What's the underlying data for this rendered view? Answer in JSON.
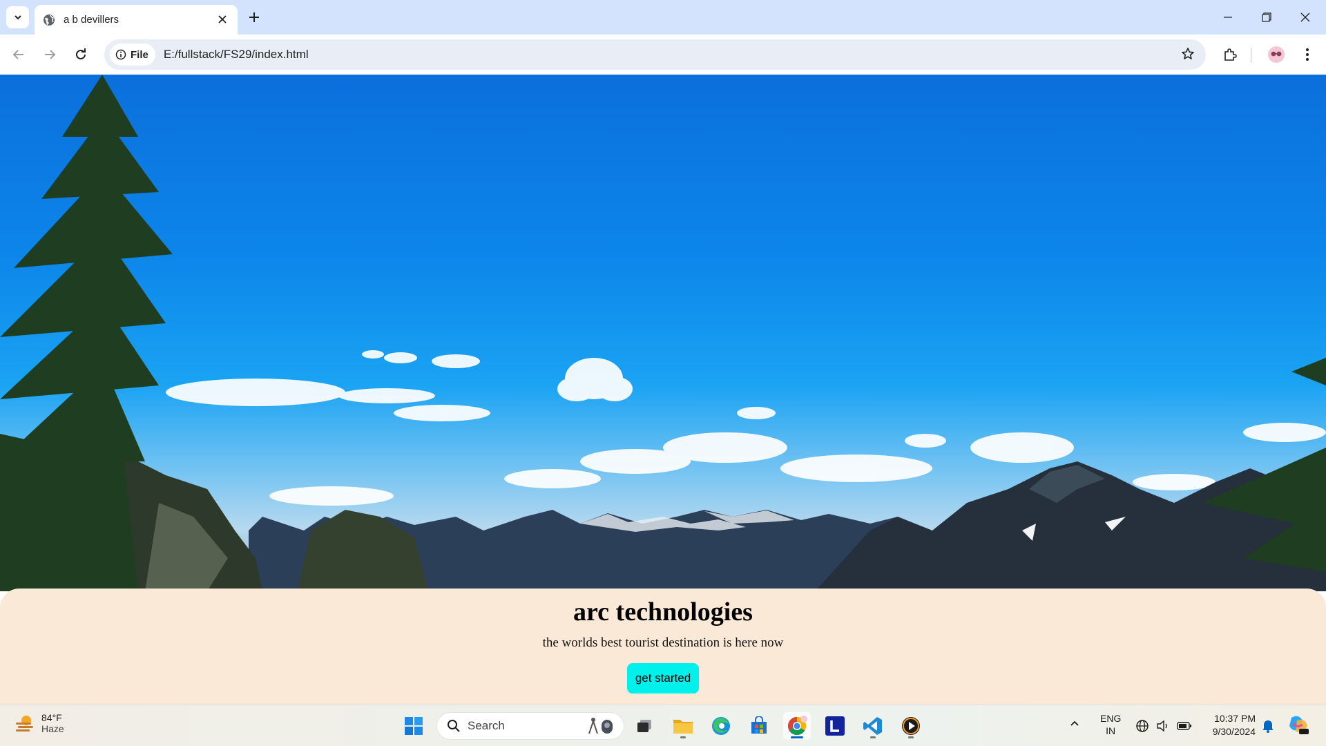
{
  "browser": {
    "tab_title": "a b devillers",
    "omnibox": {
      "scheme_chip": "File",
      "url": "E:/fullstack/FS29/index.html"
    }
  },
  "page": {
    "hero_image": "mountain-landscape-photo",
    "heading": "arc technologies",
    "subheading": "the worlds best tourist destination is here now",
    "cta_label": "get started",
    "colors": {
      "content_bg": "#fae9d6",
      "cta_bg": "#00f0ec"
    }
  },
  "taskbar": {
    "weather": {
      "temp": "84°F",
      "condition": "Haze"
    },
    "search_label": "Search",
    "apps": [
      "start",
      "search",
      "task-view",
      "file-explorer",
      "edge",
      "store",
      "chrome",
      "lens-app",
      "vscode",
      "media-player"
    ],
    "tray": {
      "lang": "ENG",
      "region": "IN"
    },
    "clock": {
      "time": "10:37 PM",
      "date": "9/30/2024"
    }
  }
}
